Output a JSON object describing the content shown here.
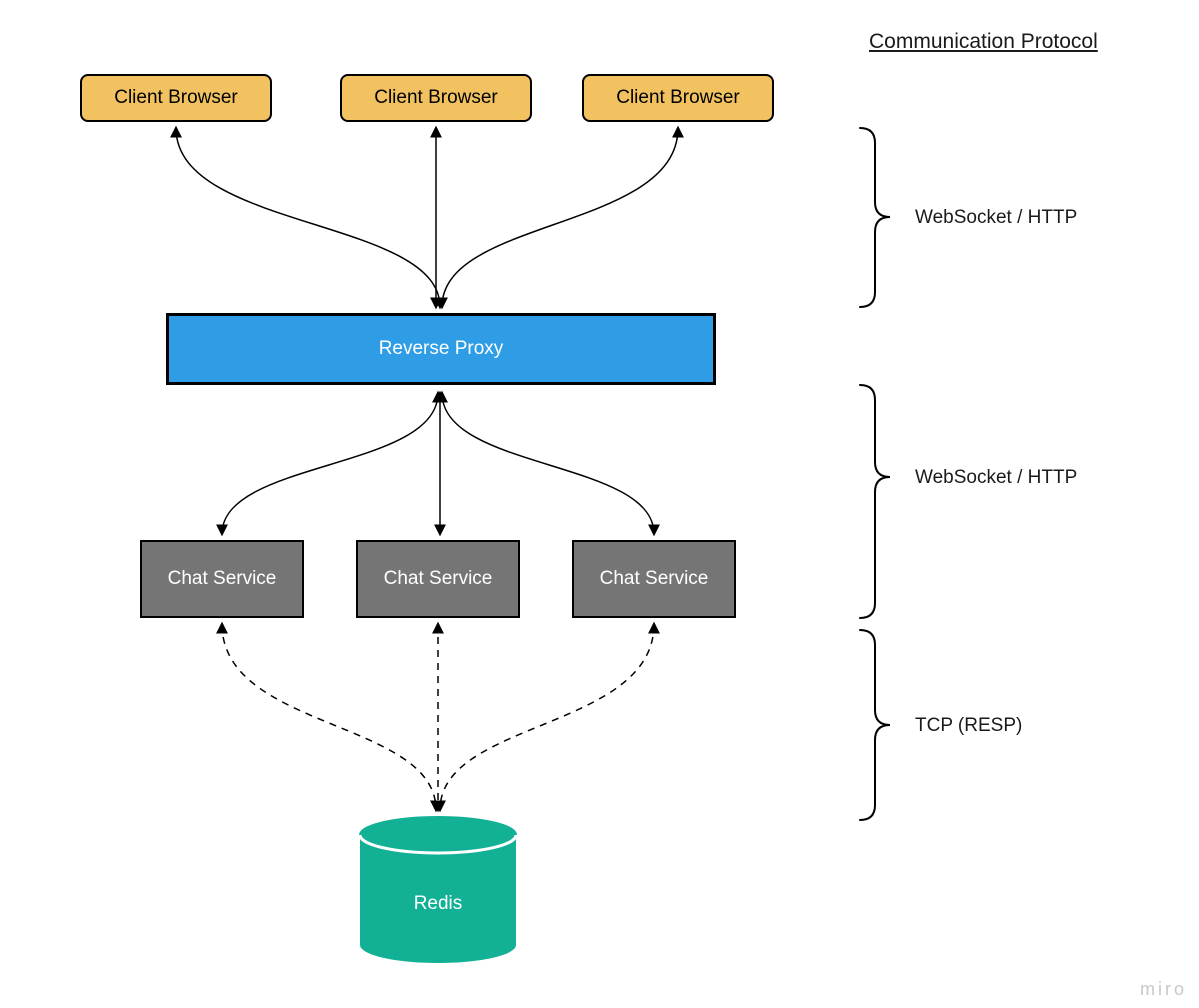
{
  "diagram": {
    "heading": "Communication Protocol",
    "nodes": {
      "client1": "Client Browser",
      "client2": "Client Browser",
      "client3": "Client Browser",
      "proxy": "Reverse Proxy",
      "service1": "Chat Service",
      "service2": "Chat Service",
      "service3": "Chat Service",
      "db": "Redis"
    },
    "protocols": {
      "layer1": "WebSocket / HTTP",
      "layer2": "WebSocket / HTTP",
      "layer3": "TCP (RESP)"
    },
    "colors": {
      "client_bg": "#f2c261",
      "proxy_bg": "#2e9de6",
      "service_bg": "#757575",
      "db_bg": "#12b196"
    },
    "watermark": "miro",
    "edges": {
      "layer1": {
        "style": "solid",
        "bidirectional": true
      },
      "layer2": {
        "style": "solid",
        "bidirectional": true
      },
      "layer3": {
        "style": "dashed",
        "bidirectional": true
      }
    }
  }
}
